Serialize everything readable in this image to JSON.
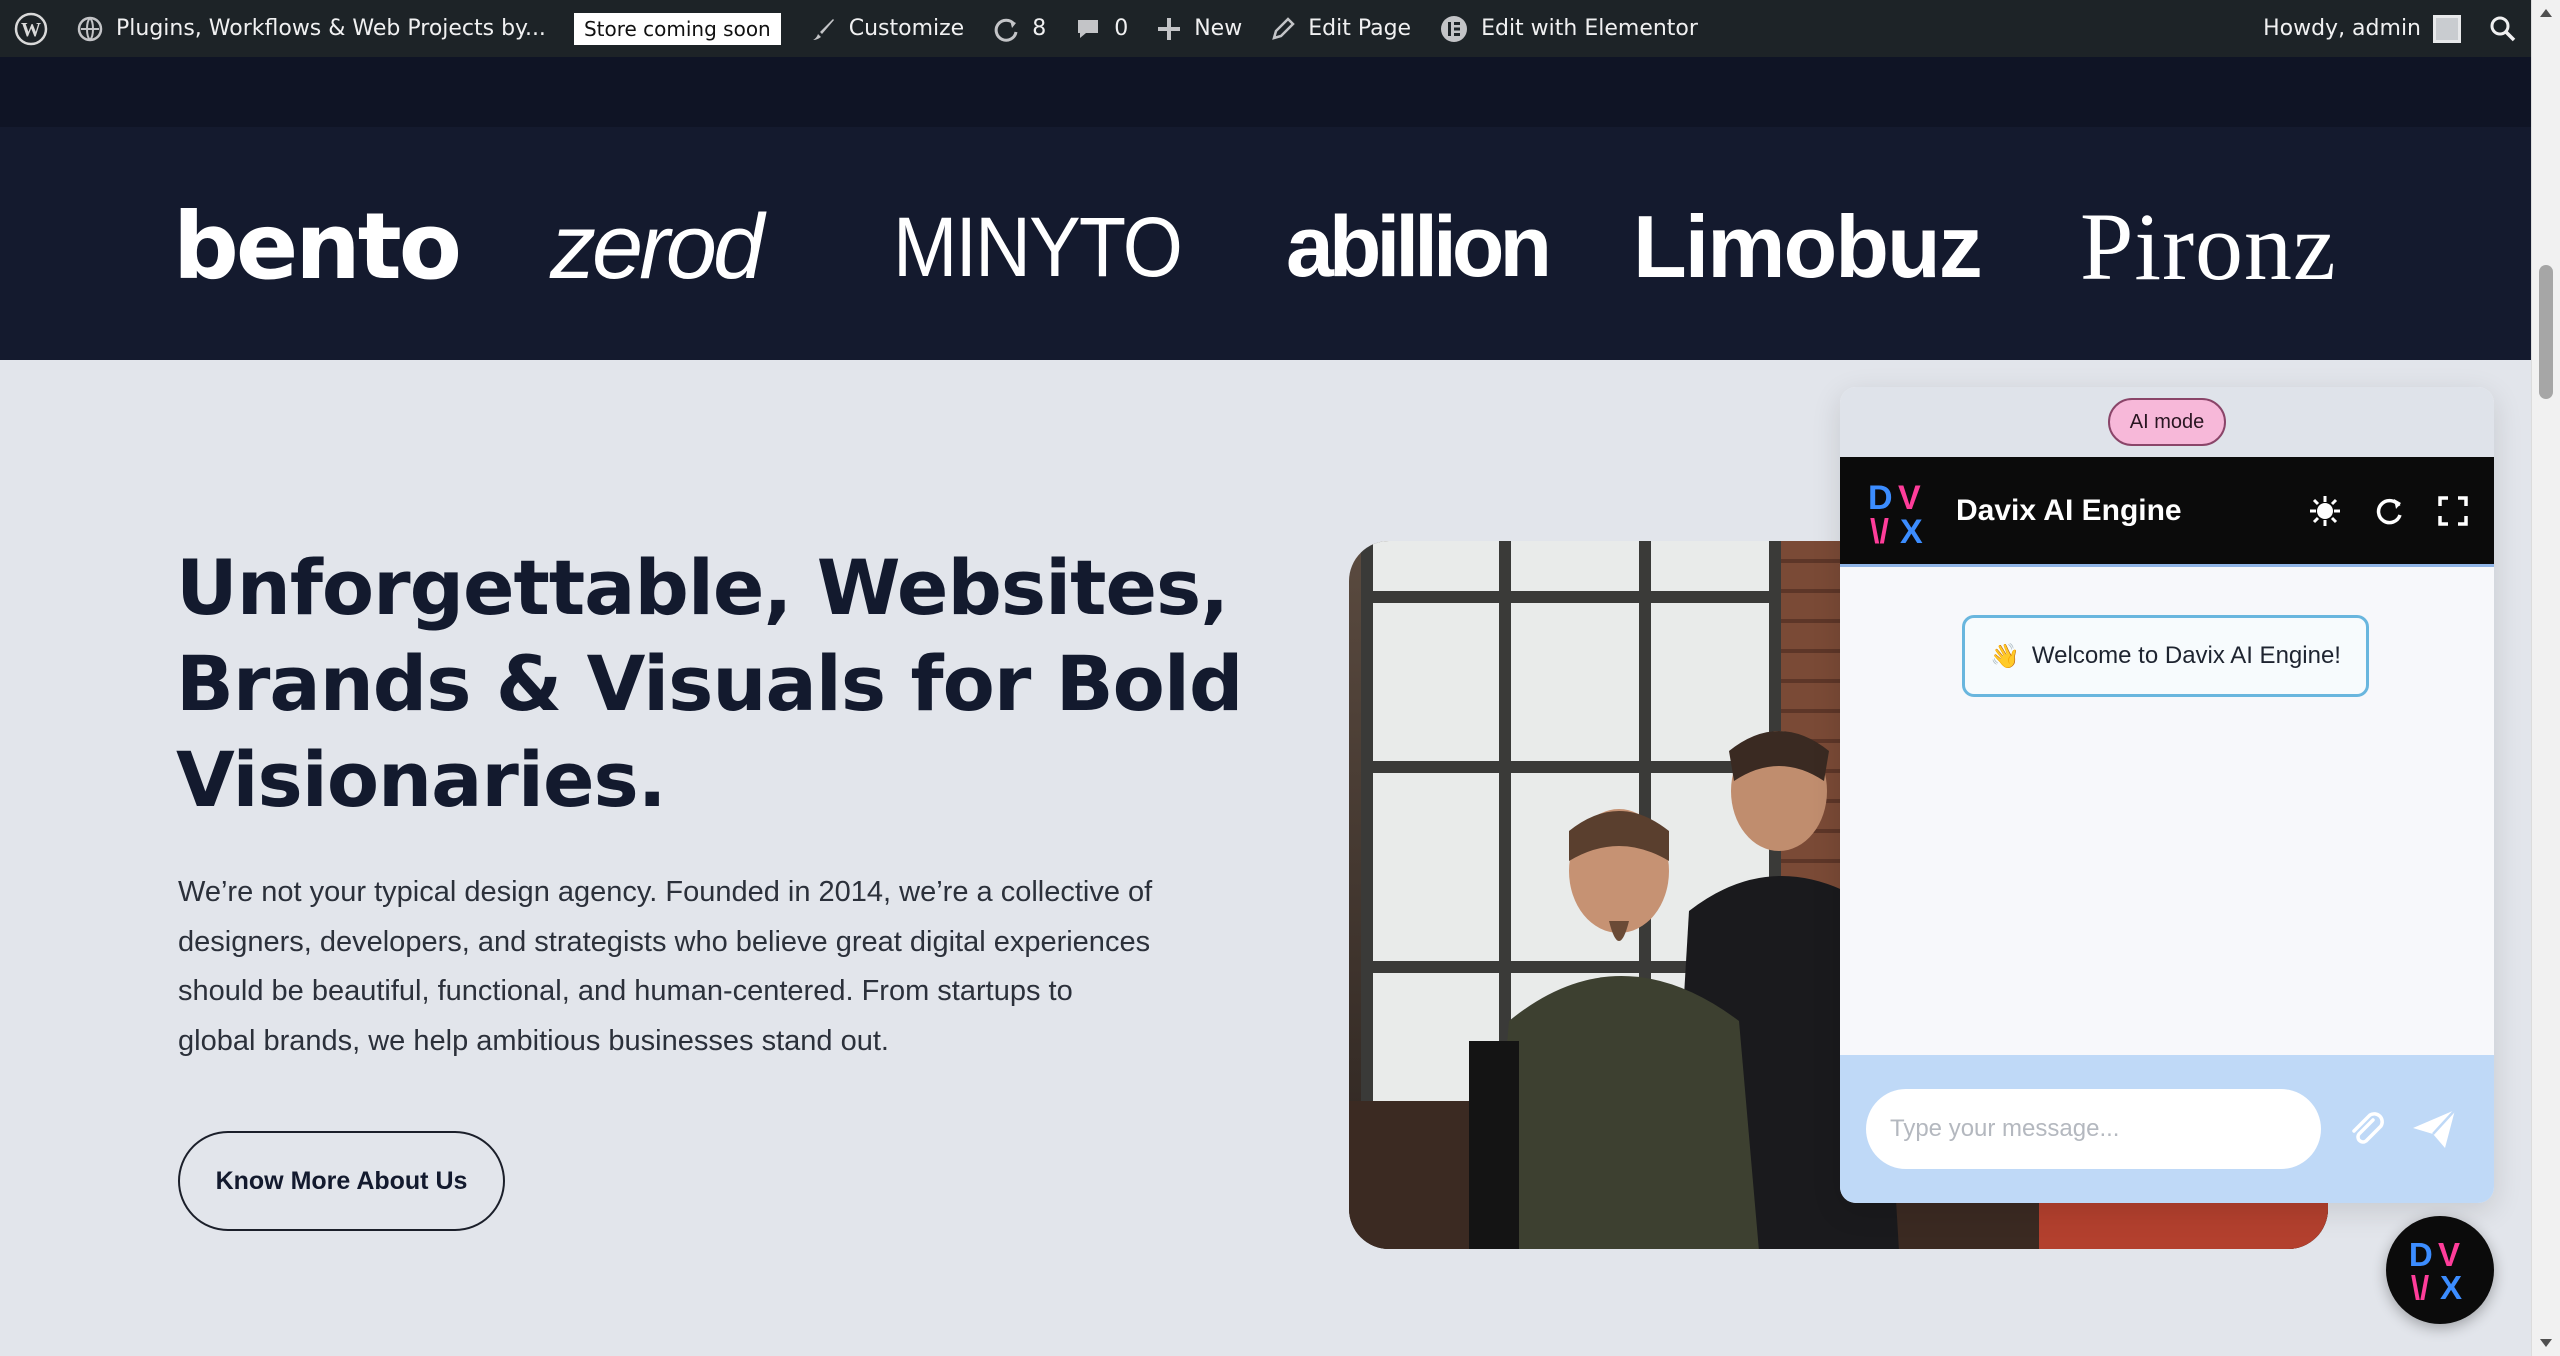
{
  "admin_bar": {
    "site_name": "Plugins, Workflows & Web Projects by...",
    "store_badge": "Store coming soon",
    "customize": "Customize",
    "updates_count": "8",
    "comments_count": "0",
    "new_label": "New",
    "edit_page": "Edit Page",
    "edit_elementor": "Edit with Elementor",
    "howdy": "Howdy, admin"
  },
  "logos": {
    "bento": "bento",
    "zerod": "zerod",
    "minyto": "MINYTO",
    "abillion": "abillion",
    "limobuz": "Limobuz",
    "pironz": "Pironz"
  },
  "hero": {
    "title_line1": "Unforgettable, Websites,",
    "title_line2": "Brands & Visuals for Bold",
    "title_line3": "Visionaries.",
    "desc_line1": "We’re not your typical design agency. Founded in 2014, we’re a collective of",
    "desc_line2": "designers, developers, and strategists who believe great digital experiences",
    "desc_line3": "should be beautiful, functional, and human-centered. From startups to",
    "desc_line4": "global brands, we help ambitious businesses stand out.",
    "cta": "Know More About Us"
  },
  "chat": {
    "mode": "AI mode",
    "title": "Davix AI Engine",
    "welcome_emoji": "👋",
    "welcome": "Welcome to Davix AI Engine!",
    "input_placeholder": "Type your message..."
  },
  "colors": {
    "admin_bar": "#1d2327",
    "logo_band": "#141a2e",
    "hero_bg": "#e2e5eb",
    "hero_text": "#131a2e",
    "chat_header": "#0b0b0b",
    "chat_footer": "#bfd9f7",
    "mode_pill": "#f7b8d9",
    "brand_pink": "#ff3d9a",
    "brand_blue": "#3c8dff"
  },
  "icons": {
    "wp": "wordpress-logo-icon",
    "site": "home-icon",
    "customize": "paintbrush-icon",
    "updates": "refresh-icon",
    "comments": "comment-icon",
    "new": "plus-icon",
    "edit": "pencil-icon",
    "elementor": "elementor-icon",
    "search": "search-icon",
    "theme": "sun-icon",
    "reload": "reload-icon",
    "fullscreen": "fullscreen-icon",
    "attach": "paperclip-icon",
    "send": "send-icon"
  }
}
